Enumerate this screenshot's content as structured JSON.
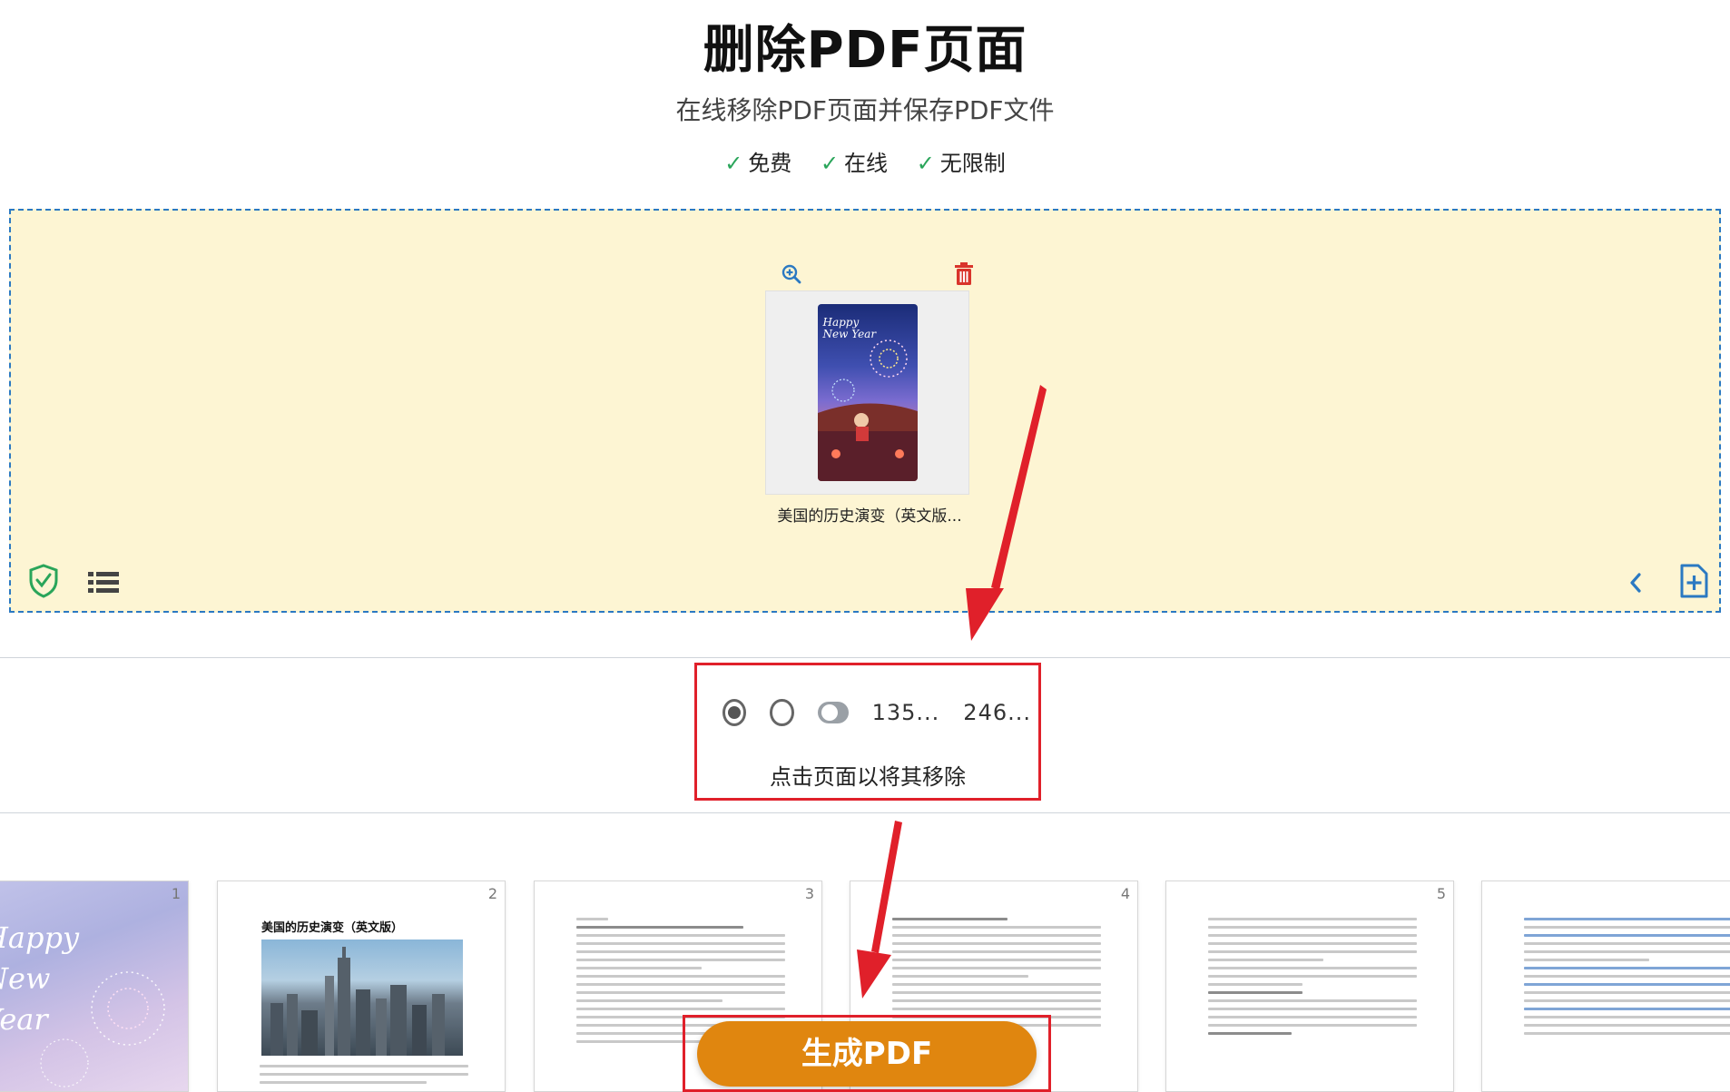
{
  "header": {
    "title": "删除PDF页面",
    "subtitle": "在线移除PDF页面并保存PDF文件",
    "features": [
      "免费",
      "在线",
      "无限制"
    ]
  },
  "dropzone": {
    "file_name": "美国的历史演变（英文版...",
    "thumbnail_caption": "Happy New Year"
  },
  "options": {
    "range_a": "135...",
    "range_b": "246...",
    "instruction": "点击页面以将其移除",
    "selected_radio": 1
  },
  "pages": {
    "numbers": [
      "1",
      "2",
      "3",
      "4",
      "5"
    ],
    "page2_heading": "美国的历史演变（英文版）"
  },
  "actions": {
    "generate_label": "生成PDF"
  },
  "colors": {
    "dropzone_bg": "#fdf5d3",
    "dropzone_border": "#2b79c2",
    "check": "#2aa55a",
    "generate_button": "#e0860f",
    "annotation_red": "#e0202a",
    "accent_blue": "#2b79c2"
  }
}
